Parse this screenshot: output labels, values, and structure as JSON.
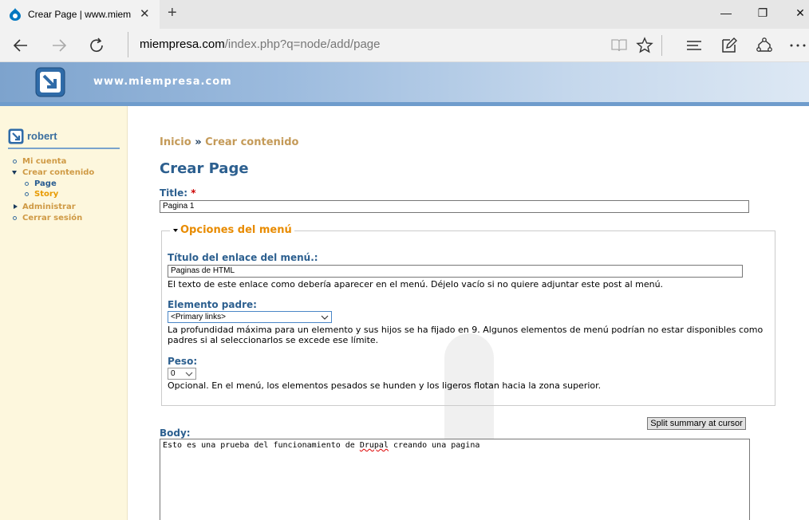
{
  "browser": {
    "tab_title": "Crear Page | www.miem",
    "close_tab_symbol": "✕",
    "new_tab_symbol": "+",
    "url_host": "miempresa.com",
    "url_path": "/index.php?q=node/add/page",
    "window_controls": {
      "minimize": "—",
      "restore": "❐",
      "close": "✕"
    },
    "icons": [
      "back-icon",
      "forward-icon",
      "refresh-icon",
      "reading-view-icon",
      "favorite-star-icon",
      "hub-icon",
      "web-note-icon",
      "share-icon",
      "more-icon"
    ]
  },
  "site": {
    "name": "www.miempresa.com",
    "logo_icon": "arrow-logo-icon",
    "header_color": "#7da3cd"
  },
  "sidebar": {
    "username": "robert",
    "items": [
      {
        "label": "Mi cuenta",
        "level": 0,
        "marker": "bullet"
      },
      {
        "label": "Crear contenido",
        "level": 0,
        "marker": "expanded"
      },
      {
        "label": "Page",
        "level": 1,
        "marker": "bullet"
      },
      {
        "label": "Story",
        "level": 1,
        "marker": "bullet"
      },
      {
        "label": "Administrar",
        "level": 0,
        "marker": "collapsed"
      },
      {
        "label": "Cerrar sesión",
        "level": 0,
        "marker": "bullet"
      }
    ]
  },
  "main": {
    "breadcrumb": {
      "home": "Inicio",
      "separator": "»",
      "current": "Crear contenido"
    },
    "page_title": "Crear Page",
    "title_field": {
      "label": "Title:",
      "required_mark": "*",
      "value": "Pagina 1"
    },
    "menu_fieldset": {
      "legend": "Opciones del menú",
      "link_title": {
        "label": "Título del enlace del menú.:",
        "value": "Paginas de HTML",
        "description": "El texto de este enlace como debería aparecer en el menú. Déjelo vacío si no quiere adjuntar este post al menú."
      },
      "parent": {
        "label": "Elemento padre:",
        "selected": "<Primary links>",
        "description_line1": "La profundidad máxima para un elemento y sus hijos se ha fijado en 9. Algunos elementos de menú podrían no estar disponibles como",
        "description_line2": "padres si al seleccionarlos se excede ese límite."
      },
      "weight": {
        "label": "Peso:",
        "selected": "0",
        "description": "Opcional. En el menú, los elementos pesados se hunden y los ligeros flotan hacia la zona superior."
      }
    },
    "split_button": "Split summary at cursor",
    "body": {
      "label": "Body:",
      "text_before": "Esto es una prueba del funcionamiento de ",
      "text_misspelled": "Drupal",
      "text_after": " creando una pagina"
    }
  },
  "colors": {
    "link_orange": "#c49a58",
    "active_orange": "#e89a00",
    "heading_blue": "#2c5f8f",
    "sidebar_bg": "#fdf7dd",
    "required_red": "#cc0000"
  }
}
